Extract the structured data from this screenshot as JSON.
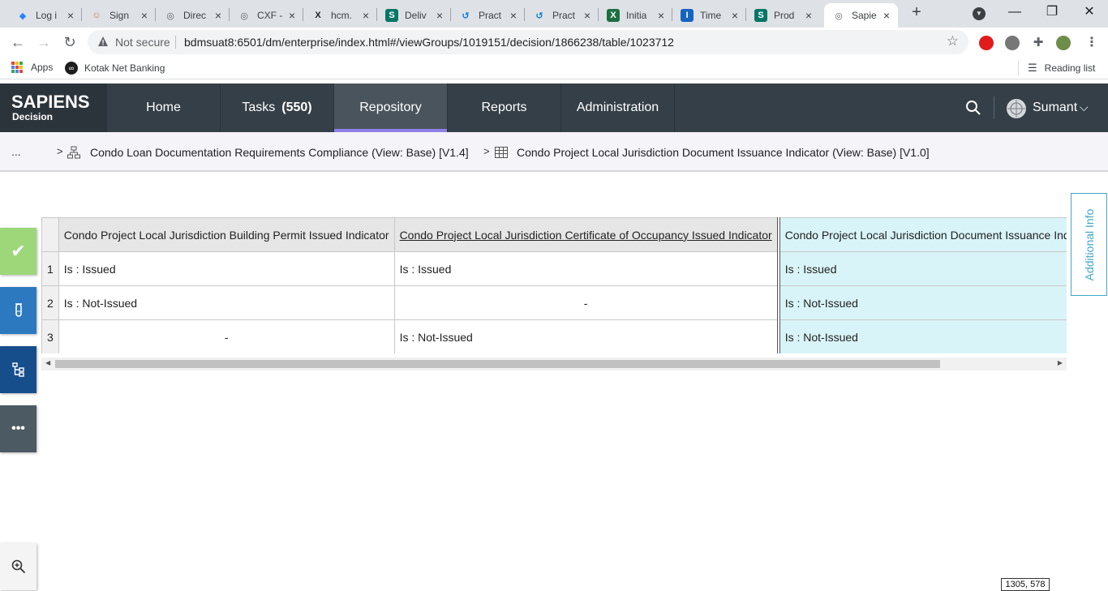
{
  "browser": {
    "tabs": [
      {
        "label": "Log i",
        "icon": "jira-icon",
        "color": "#2684ff"
      },
      {
        "label": "Sign",
        "icon": "avatar-icon",
        "color": "#c08060"
      },
      {
        "label": "Direc",
        "icon": "globe-icon",
        "color": "#5f6368"
      },
      {
        "label": "CXF -",
        "icon": "globe-icon",
        "color": "#5f6368"
      },
      {
        "label": "hcm.",
        "icon": "x-icon",
        "color": "#202124"
      },
      {
        "label": "Deliv",
        "icon": "sharepoint-icon",
        "color": "#077568"
      },
      {
        "label": "Pract",
        "icon": "sync-icon",
        "color": "#0078d4"
      },
      {
        "label": "Pract",
        "icon": "sync-icon",
        "color": "#0078d4"
      },
      {
        "label": "Initia",
        "icon": "excel-icon",
        "color": "#1d6f42"
      },
      {
        "label": "Time",
        "icon": "time-icon",
        "color": "#1565c0"
      },
      {
        "label": "Prod",
        "icon": "sharepoint-icon",
        "color": "#077568"
      },
      {
        "label": "Sapie",
        "icon": "globe-icon",
        "color": "#5f6368",
        "active": true
      }
    ],
    "new_tab": "+",
    "not_secure": "Not secure",
    "url": "bdmsuat8:6501/dm/enterprise/index.html#/viewGroups/1019151/decision/1866238/table/1023712",
    "bookmarks": {
      "apps": "Apps",
      "kotak": "Kotak Net Banking",
      "reading_list": "Reading list"
    }
  },
  "app": {
    "logo_main": "SAPIENS",
    "logo_sub": "Decision",
    "nav": [
      {
        "label": "Home"
      },
      {
        "label": "Tasks",
        "badge": "(550)"
      },
      {
        "label": "Repository",
        "active": true
      },
      {
        "label": "Reports"
      },
      {
        "label": "Administration"
      }
    ],
    "user": "Sumant",
    "accent": "#8e82e6"
  },
  "breadcrumb": {
    "ellipsis": "...",
    "parent": "Condo Loan Documentation Requirements Compliance (View: Base) [V1.4]",
    "current": "Condo Project Local Jurisdiction Document Issuance Indicator (View: Base) [V1.0]"
  },
  "table": {
    "headers": [
      "Condo Project Local Jurisdiction Building Permit Issued Indicator",
      "Condo Project Local Jurisdiction Certificate of Occupancy Issued Indicator",
      "Condo Project Local Jurisdiction Document Issuance Indicator"
    ],
    "rows": [
      {
        "num": "1",
        "cells": [
          "Is : Issued",
          "Is : Issued",
          "Is : Issued"
        ]
      },
      {
        "num": "2",
        "cells": [
          "Is : Not-Issued",
          "-",
          "Is : Not-Issued"
        ]
      },
      {
        "num": "3",
        "cells": [
          "-",
          "Is : Not-Issued",
          "Is : Not-Issued"
        ]
      }
    ]
  },
  "additional_info": "Additional Info",
  "coordinates": "1305, 578"
}
